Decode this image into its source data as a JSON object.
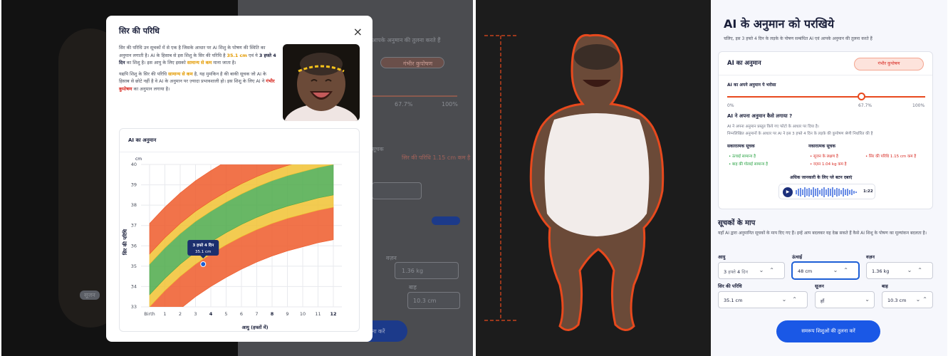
{
  "modal": {
    "title": "सिर की परिधि",
    "close_glyph": "×",
    "p1_a": "सिर की परिधि उन सूचकों में से एक है जिसके आधार पर AI शिशु के पोषण की स्थिति का अनुमान लगाती है। AI के हिसाब से इस शिशु के सिर की परिधि है ",
    "p1_value": "35.1 cm",
    "p1_b": " एवं ये ",
    "p1_age": "3 हफ्ते 4 दिन",
    "p1_c": " का शिशु है। इस आयु के लिए इसको ",
    "p1_below": "सामान्य से कम",
    "p1_d": " माना जाता है।",
    "p2_a": "यद्यपि शिशु के सिर की परिधि ",
    "p2_below": "सामान्य से कम",
    "p2_b": " है, यह मुमकिन है की बाकी सूचक जो AI के हिसाब से छोटे नहीं है वे AI के अनुमान पर ज़्यादा प्रभावशाली हो। इस शिशु के लिए AI ने ",
    "p2_severe": "गंभीर कुपोषण",
    "p2_c": " का अनुमान लगाया है।"
  },
  "chart_card": {
    "title": "AI का अनुमान"
  },
  "chart_data": {
    "type": "area",
    "title": "",
    "xlabel": "आयु (हफ्तों में)",
    "ylabel": "सिर की परिधि",
    "y_unit": "cm",
    "x_ticks": [
      "Birth",
      "1",
      "2",
      "3",
      "4",
      "5",
      "6",
      "7",
      "8",
      "9",
      "10",
      "11",
      "12"
    ],
    "x_highlight": [
      "4",
      "8",
      "12"
    ],
    "ylim": [
      33,
      40
    ],
    "y_ticks": [
      33,
      34,
      35,
      36,
      37,
      38,
      39,
      40
    ],
    "grid": true,
    "bands": [
      {
        "name": "red-low",
        "color": "#ee5a2a",
        "lower": [
          31.4,
          32.2,
          32.9,
          33.5,
          34.0,
          34.45,
          34.85,
          35.2,
          35.5,
          35.75,
          35.95,
          36.15,
          36.3
        ],
        "upper": [
          33.0,
          33.8,
          34.5,
          35.1,
          35.6,
          36.05,
          36.45,
          36.8,
          37.1,
          37.35,
          37.55,
          37.75,
          37.9
        ]
      },
      {
        "name": "yellow-low",
        "color": "#f1c232",
        "lower": [
          33.0,
          33.8,
          34.5,
          35.1,
          35.6,
          36.05,
          36.45,
          36.8,
          37.1,
          37.35,
          37.55,
          37.75,
          37.9
        ],
        "upper": [
          33.6,
          34.4,
          35.1,
          35.7,
          36.2,
          36.65,
          37.05,
          37.4,
          37.7,
          37.95,
          38.15,
          38.35,
          38.5
        ]
      },
      {
        "name": "green",
        "color": "#4daa4a",
        "lower": [
          33.6,
          34.4,
          35.1,
          35.7,
          36.2,
          36.65,
          37.05,
          37.4,
          37.7,
          37.95,
          38.15,
          38.35,
          38.5
        ],
        "upper": [
          35.1,
          35.9,
          36.6,
          37.2,
          37.7,
          38.15,
          38.55,
          38.9,
          39.2,
          39.45,
          39.65,
          39.85,
          40.0
        ]
      },
      {
        "name": "yellow-high",
        "color": "#f1c232",
        "lower": [
          35.1,
          35.9,
          36.6,
          37.2,
          37.7,
          38.15,
          38.55,
          38.9,
          39.2,
          39.45,
          39.65,
          39.85,
          40.0
        ],
        "upper": [
          35.6,
          36.4,
          37.1,
          37.7,
          38.2,
          38.65,
          39.05,
          39.4,
          39.7,
          39.95,
          40.15,
          40.35,
          40.5
        ]
      },
      {
        "name": "red-high",
        "color": "#ee5a2a",
        "lower": [
          35.6,
          36.4,
          37.1,
          37.7,
          38.2,
          38.65,
          39.05,
          39.4,
          39.7,
          39.95,
          40.15,
          40.35,
          40.5
        ],
        "upper": [
          37.1,
          37.9,
          38.6,
          39.2,
          39.7,
          40.15,
          40.55,
          40.9,
          41.2,
          41.45,
          41.65,
          41.85,
          42.0
        ]
      }
    ],
    "point": {
      "x": 3.5,
      "y": 35.1,
      "label_line1": "3 हफ्ते 4 दिन",
      "label_line2": "35.1 cm"
    }
  },
  "right": {
    "title": "AI के अनुमान को परखिये",
    "subtitle": "चलिए, इस 3 हफ्ते 4 दिन के लड़के के पोषण सम्बंधित AI एवं आपके अनुमान की तुलना करते हैं",
    "card_title": "AI का अनुमान",
    "badge": "गंभीर कुपोषण",
    "confidence_label": "AI का अपने अनुमान पे भरोसा",
    "confidence": 0.677,
    "conf_min": "0%",
    "conf_val": "67.7%",
    "conf_max": "100%",
    "how_title": "AI ने अपना अनुमान कैसे लगाया ?",
    "how_line1": "AI ने अपना अनुमान प्रस्तुत किये गए फोटो के आधार पर दिया है।",
    "how_line2": "निम्नलिखित अनुमानों के आधार पर AI ने इस 3 हफ्ते 4 दिन के लड़के की कुपोषण श्रेणी निर्धारित की है",
    "positive_head": "सकारात्मक सूचक",
    "negative_head": "नकारात्मक सूचक",
    "positive": [
      "ऊंचाई सामान्य है",
      "बाह की गोलाई सामान्य है"
    ],
    "negative_a": [
      "सूजन के लक्षण है",
      "वज़न 1.04 kg कम है"
    ],
    "negative_b": [
      "सिर की परिधि 1.15 cm कम है"
    ],
    "audio_prompt": "अधिक जानकारी के लिए प्ले बटन दबाएं",
    "audio_time": "1:22",
    "measures_title": "सूचकों के माप",
    "measures_desc": "यहाँ AI द्वारा अनुमानित सूचकों के माप दिए गए हैं। इन्हें आप बदलकर यह देख सकते हैं कैसे AI शिशु के पोषण का मूल्यांकन बदलता है।",
    "fields": {
      "age_label": "आयु",
      "age_weeks": "3",
      "age_weeks_unit": "हफ्ते",
      "age_days": "4",
      "age_days_unit": "दिन",
      "height_label": "ऊंचाई",
      "height_value": "48 cm",
      "weight_label": "वज़न",
      "weight_value": "1.36 kg",
      "head_label": "सिर की परिधि",
      "head_value": "35.1 cm",
      "swelling_label": "सूजन",
      "swelling_value": "हाँ",
      "arm_label": "बाह",
      "arm_value": "10.3 cm"
    },
    "cta": "समरूप शिशुओं की तुलना करें"
  },
  "background": {
    "header_fragment": "आपके अनुमान की तुलना करते हैं",
    "badge_fragment": "गंभीर कुपोषण",
    "conf_mid": "67.7%",
    "conf_max": "100%",
    "pos_fragment": "सूचक",
    "neg_fragment": "सिर की परिधि 1.15 cm कम है",
    "weight_fragment": "वज़न",
    "weight_value": "1.36 kg",
    "arm_fragment": "बाह",
    "arm_value": "10.3 cm",
    "button_fragment": "ना करें",
    "swelling_chip": "सूजन"
  },
  "colors": {
    "accent": "#1a58e6",
    "severe": "#d7261e",
    "normal": "#1e9e3a",
    "outline": "#e8491d"
  }
}
